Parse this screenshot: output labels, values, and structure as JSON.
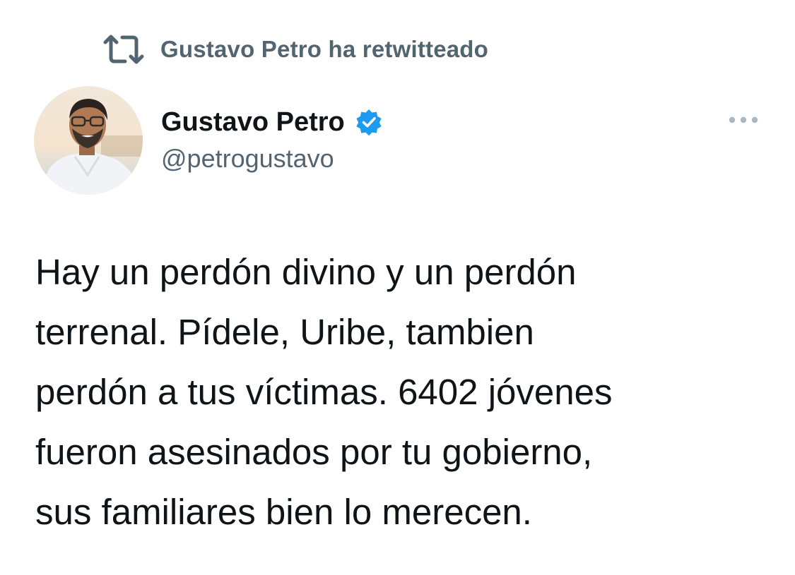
{
  "retweet": {
    "icon": "retweet-icon",
    "label": "Gustavo Petro ha retwitteado"
  },
  "author": {
    "avatar": "avatar",
    "display_name": "Gustavo Petro",
    "verified_icon": "verified-badge-icon",
    "handle": "@petrogustavo"
  },
  "more_icon": "more-options-icon",
  "tweet": {
    "lines": [
      "Hay un perdón divino y un perdón",
      "terrenal. Pídele, Uribe, tambien",
      "perdón a tus víctimas. 6402 jóvenes",
      "fueron asesinados por tu gobierno,",
      "sus familiares bien lo merecen."
    ]
  },
  "colors": {
    "text": "#0f1419",
    "secondary": "#536471",
    "verified": "#1d9bf0",
    "more_icon": "#aab8c2"
  }
}
